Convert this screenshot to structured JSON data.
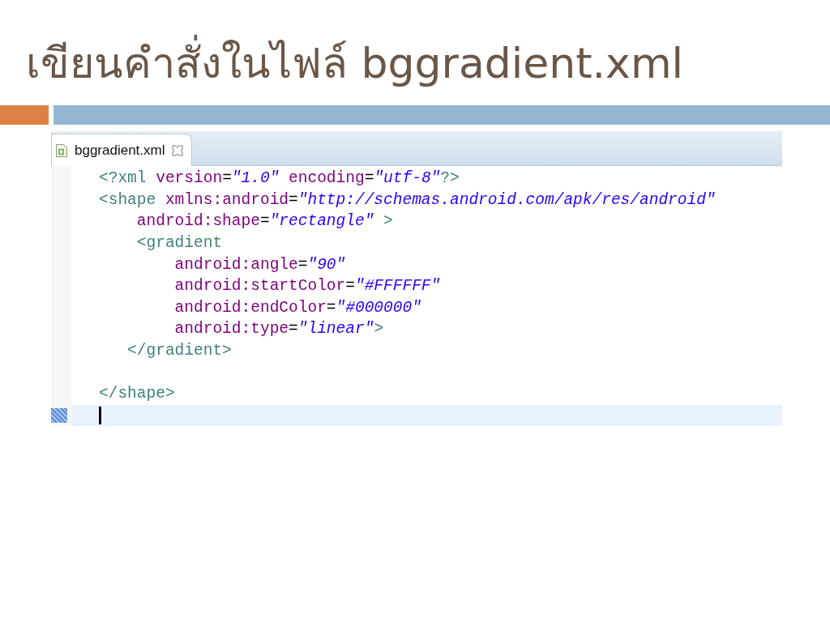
{
  "slide_title": "เขียนคำสั่งในไฟล์ bggradient.xml",
  "editor": {
    "tabs": [
      {
        "label": "bggradient.xml",
        "selected": true
      }
    ],
    "lines": [
      {
        "current": false,
        "tokens": [
          {
            "kind": "tag",
            "text": "<?xml"
          },
          {
            "kind": "attr",
            "text": " version"
          },
          {
            "kind": "punct",
            "text": "="
          },
          {
            "kind": "value",
            "text": "\"1.0\""
          },
          {
            "kind": "attr",
            "text": " encoding"
          },
          {
            "kind": "punct",
            "text": "="
          },
          {
            "kind": "value",
            "text": "\"utf-8\""
          },
          {
            "kind": "tag",
            "text": "?>"
          }
        ]
      },
      {
        "current": false,
        "tokens": [
          {
            "kind": "tag",
            "text": "<shape"
          },
          {
            "kind": "attr",
            "text": " xmlns:android"
          },
          {
            "kind": "punct",
            "text": "="
          },
          {
            "kind": "value",
            "text": "\"http://schemas.android.com/apk/res/android\""
          }
        ]
      },
      {
        "current": false,
        "tokens": [
          {
            "kind": "attr",
            "text": "    android:shape"
          },
          {
            "kind": "punct",
            "text": "="
          },
          {
            "kind": "value",
            "text": "\"rectangle\""
          },
          {
            "kind": "tag",
            "text": " >"
          }
        ]
      },
      {
        "current": false,
        "tokens": [
          {
            "kind": "tag",
            "text": "    <gradient"
          }
        ]
      },
      {
        "current": false,
        "tokens": [
          {
            "kind": "attr",
            "text": "        android:angle"
          },
          {
            "kind": "punct",
            "text": "="
          },
          {
            "kind": "value",
            "text": "\"90\""
          }
        ]
      },
      {
        "current": false,
        "tokens": [
          {
            "kind": "attr",
            "text": "        android:startColor"
          },
          {
            "kind": "punct",
            "text": "="
          },
          {
            "kind": "value",
            "text": "\"#FFFFFF\""
          }
        ]
      },
      {
        "current": false,
        "tokens": [
          {
            "kind": "attr",
            "text": "        android:endColor"
          },
          {
            "kind": "punct",
            "text": "="
          },
          {
            "kind": "value",
            "text": "\"#000000\""
          }
        ]
      },
      {
        "current": false,
        "tokens": [
          {
            "kind": "attr",
            "text": "        android:type"
          },
          {
            "kind": "punct",
            "text": "="
          },
          {
            "kind": "value",
            "text": "\"linear\""
          },
          {
            "kind": "tag",
            "text": ">"
          }
        ]
      },
      {
        "current": false,
        "tokens": [
          {
            "kind": "tag",
            "text": "   </gradient>"
          }
        ]
      },
      {
        "current": false
      },
      {
        "current": false,
        "tokens": [
          {
            "kind": "tag",
            "text": "</shape>"
          }
        ]
      },
      {
        "current": true
      }
    ]
  }
}
